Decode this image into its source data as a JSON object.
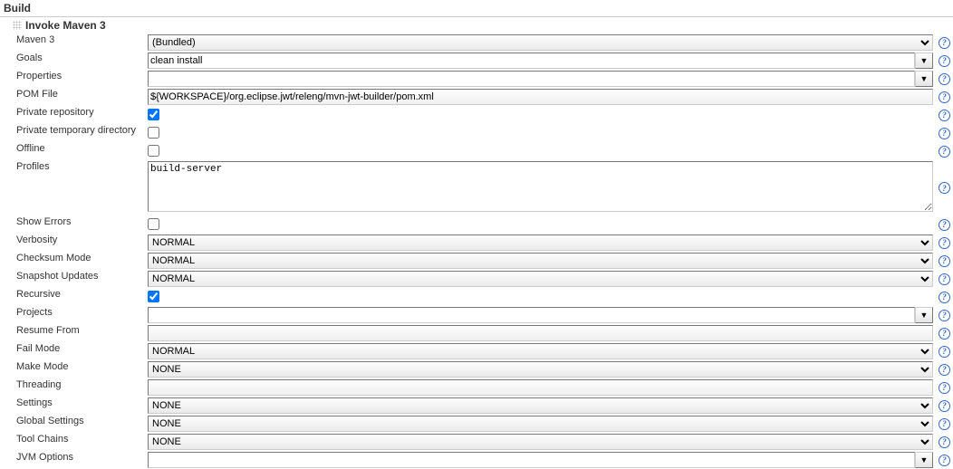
{
  "section": {
    "title": "Build"
  },
  "subsection": {
    "title": "Invoke Maven 3"
  },
  "fields": {
    "maven3": {
      "label": "Maven 3",
      "value": "(Bundled)"
    },
    "goals": {
      "label": "Goals",
      "value": "clean install"
    },
    "properties": {
      "label": "Properties",
      "value": ""
    },
    "pomFile": {
      "label": "POM File",
      "value": "${WORKSPACE}/org.eclipse.jwt/releng/mvn-jwt-builder/pom.xml"
    },
    "privateRepo": {
      "label": "Private repository",
      "checked": true
    },
    "privateTemp": {
      "label": "Private temporary directory",
      "checked": false
    },
    "offline": {
      "label": "Offline",
      "checked": false
    },
    "profiles": {
      "label": "Profiles",
      "value": "build-server"
    },
    "showErrors": {
      "label": "Show Errors",
      "checked": false
    },
    "verbosity": {
      "label": "Verbosity",
      "value": "NORMAL"
    },
    "checksumMode": {
      "label": "Checksum Mode",
      "value": "NORMAL"
    },
    "snapshotUpdates": {
      "label": "Snapshot Updates",
      "value": "NORMAL"
    },
    "recursive": {
      "label": "Recursive",
      "checked": true
    },
    "projects": {
      "label": "Projects",
      "value": ""
    },
    "resumeFrom": {
      "label": "Resume From",
      "value": ""
    },
    "failMode": {
      "label": "Fail Mode",
      "value": "NORMAL"
    },
    "makeMode": {
      "label": "Make Mode",
      "value": "NONE"
    },
    "threading": {
      "label": "Threading",
      "value": ""
    },
    "settings": {
      "label": "Settings",
      "value": "NONE"
    },
    "globalSettings": {
      "label": "Global Settings",
      "value": "NONE"
    },
    "toolChains": {
      "label": "Tool Chains",
      "value": "NONE"
    },
    "jvmOptions": {
      "label": "JVM Options",
      "value": ""
    }
  },
  "glyphs": {
    "helpQ": "?",
    "dropdown": "▼"
  }
}
